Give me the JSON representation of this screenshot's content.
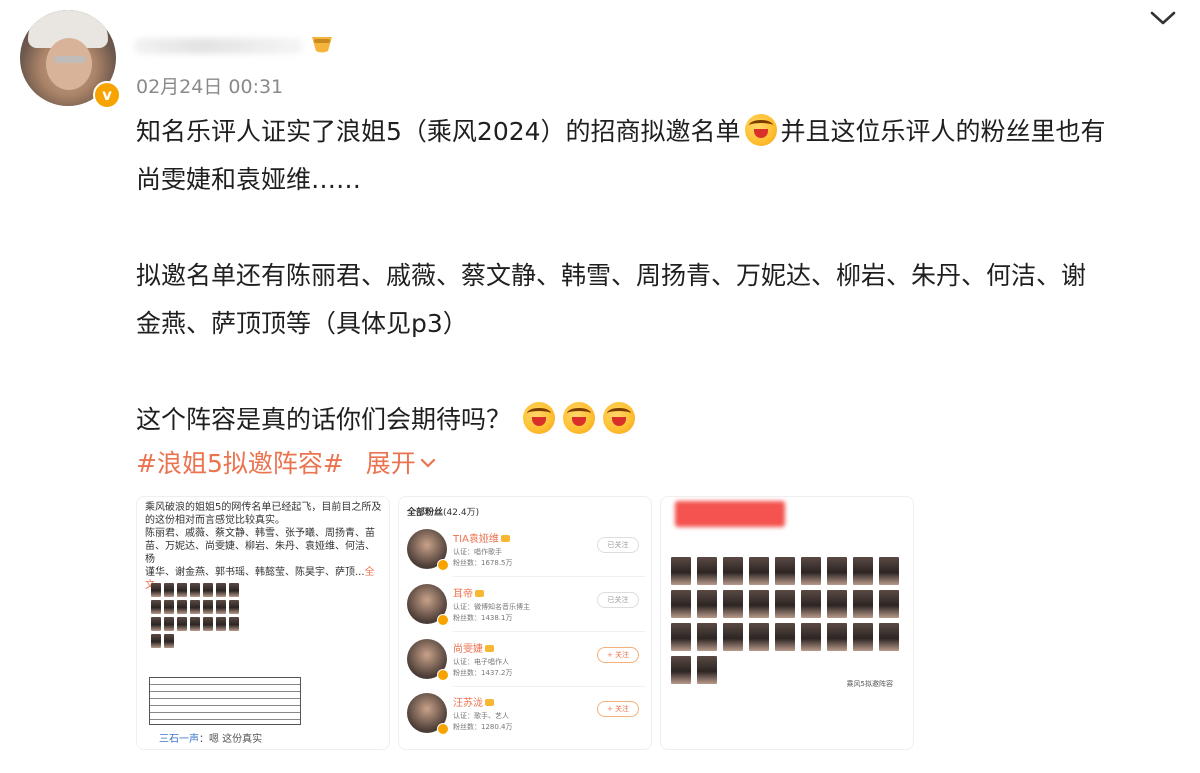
{
  "post": {
    "author": {
      "avatar_icon": "user-avatar-icon",
      "verified_badge": "v",
      "name_emoji_icon": "sunglasses-emoji-icon"
    },
    "timestamp": "02月24日 00:31",
    "expand_icon": "chevron-down-icon",
    "text": {
      "line1": "知名乐评人证实了浪姐5（乘风2024）的招商拟邀名单",
      "line1_tail": "并且这位乐评人的粉丝里也有",
      "line2": "尚雯婕和袁娅维……",
      "line3": "拟邀名单还有陈丽君、戚薇、蔡文静、韩雪、周扬青、万妮达、柳岩、朱丹、何洁、谢",
      "line4": "金燕、萨顶顶等（具体见p3）",
      "line5": "这个阵容是真的话你们会期待吗？"
    },
    "topic": "#浪姐5拟邀阵容#",
    "expand_label": "展开",
    "accent_color": "#eb7350",
    "images": [
      {
        "text_lines": [
          "乘风破浪的姐姐5的网传名单已经起飞，目前目之所及",
          "的这份相对而言感觉比较真实。",
          "陈丽君、戚薇、蔡文静、韩雪、张予曦、周扬青、苗",
          "苗、万妮达、尚雯婕、柳岩、朱丹、袁娅维、何洁、杨",
          "谨华、谢金燕、郭书瑶、韩懿莹、陈昊宇、萨顶..."
        ],
        "more_link": "全文",
        "footer_user": "三石一声",
        "footer_text": "嗯 这份真实"
      },
      {
        "header": "全部粉丝",
        "header_count": "(42.4万)",
        "fans": [
          {
            "name": "TIA袁娅维",
            "desc": "认证：唱作歌手",
            "count": "粉丝数：1678.5万",
            "btn": "已关注",
            "followed": true
          },
          {
            "name": "耳帝",
            "desc": "认证：微博知名音乐博主",
            "count": "粉丝数：1438.1万",
            "btn": "已关注",
            "followed": true
          },
          {
            "name": "尚雯婕",
            "desc": "认证：电子唱作人",
            "count": "粉丝数：1437.2万",
            "btn": "+ 关注",
            "followed": false
          },
          {
            "name": "汪苏泷",
            "desc": "认证：歌手、艺人",
            "count": "粉丝数：1280.4万",
            "btn": "+ 关注",
            "followed": false
          }
        ]
      },
      {
        "tag": "乘风5拟邀阵容"
      }
    ]
  }
}
